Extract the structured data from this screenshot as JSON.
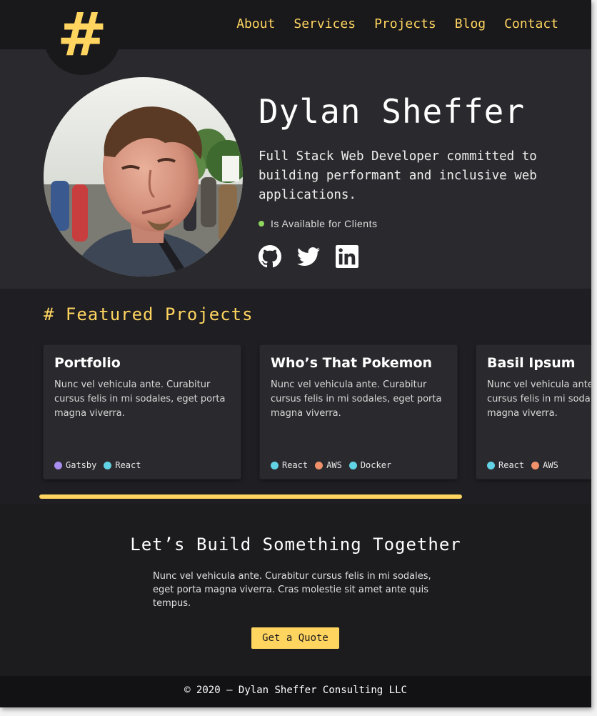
{
  "nav": {
    "logo": "#",
    "links": [
      "About",
      "Services",
      "Projects",
      "Blog",
      "Contact"
    ]
  },
  "hero": {
    "name": "Dylan Sheffer",
    "bio": "Full Stack Web Developer committed to building performant and inclusive web applications.",
    "status": "Is Available for Clients",
    "social": [
      "github-icon",
      "twitter-icon",
      "linkedin-icon"
    ]
  },
  "featured": {
    "title": "# Featured Projects",
    "projects": [
      {
        "title": "Portfolio",
        "description": "Nunc vel vehicula ante. Curabitur cursus felis in mi sodales, eget porta magna viverra.",
        "tags": [
          "Gatsby",
          "React"
        ]
      },
      {
        "title": "Who’s That Pokemon",
        "description": "Nunc vel vehicula ante. Curabitur cursus felis in mi sodales, eget porta magna viverra.",
        "tags": [
          "React",
          "AWS",
          "Docker"
        ]
      },
      {
        "title": "Basil Ipsum",
        "description": "Nunc vel vehicula ante. Curabitur cursus felis in mi sodales, eget porta magna viverra.",
        "tags": [
          "React",
          "AWS"
        ]
      }
    ]
  },
  "cta": {
    "title": "Let’s Build Something Together",
    "text": "Nunc vel vehicula ante. Curabitur cursus felis in mi sodales, eget porta magna viverra. Cras molestie sit amet ante quis tempus.",
    "button": "Get a Quote"
  },
  "footer": {
    "text": "© 2020 – Dylan Sheffer Consulting LLC"
  },
  "colors": {
    "accent": "#ffd560",
    "status_available": "#8fd65e",
    "tag_gatsby": "#a78ef0",
    "tag_react": "#62d3e4",
    "tag_aws": "#f0916a",
    "tag_docker": "#62d3e4"
  }
}
